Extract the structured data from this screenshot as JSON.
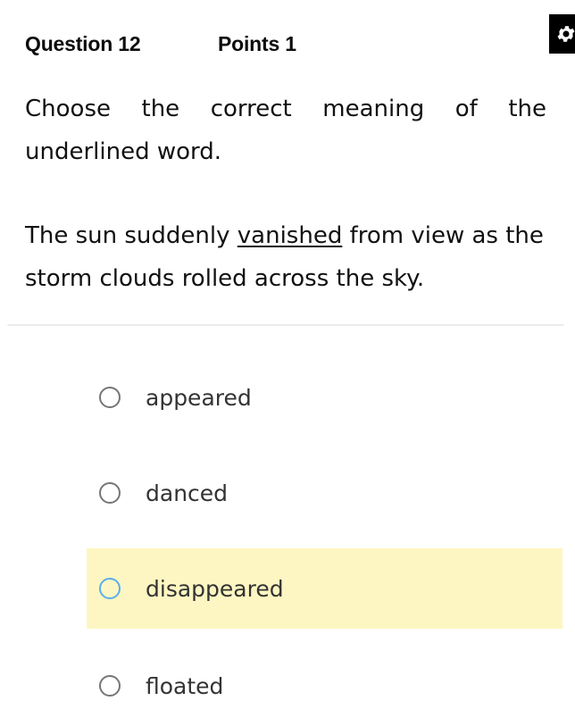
{
  "header": {
    "question_label": "Question 12",
    "points_label": "Points 1",
    "settings_icon": "gear-icon"
  },
  "question": {
    "prompt": "Choose the correct meaning of the underlined word.",
    "sentence_before": "The sun suddenly ",
    "underlined_word": "vanished",
    "sentence_after": " from view as the storm clouds rolled across the sky."
  },
  "options": [
    {
      "label": "appeared",
      "selected": false,
      "highlighted": false
    },
    {
      "label": "danced",
      "selected": false,
      "highlighted": false
    },
    {
      "label": "disappeared",
      "selected": false,
      "highlighted": true
    },
    {
      "label": "floated",
      "selected": false,
      "highlighted": false
    }
  ],
  "colors": {
    "highlight_background": "#fef6c2",
    "highlight_radio": "#5aaeeb",
    "radio_default": "#767676"
  }
}
